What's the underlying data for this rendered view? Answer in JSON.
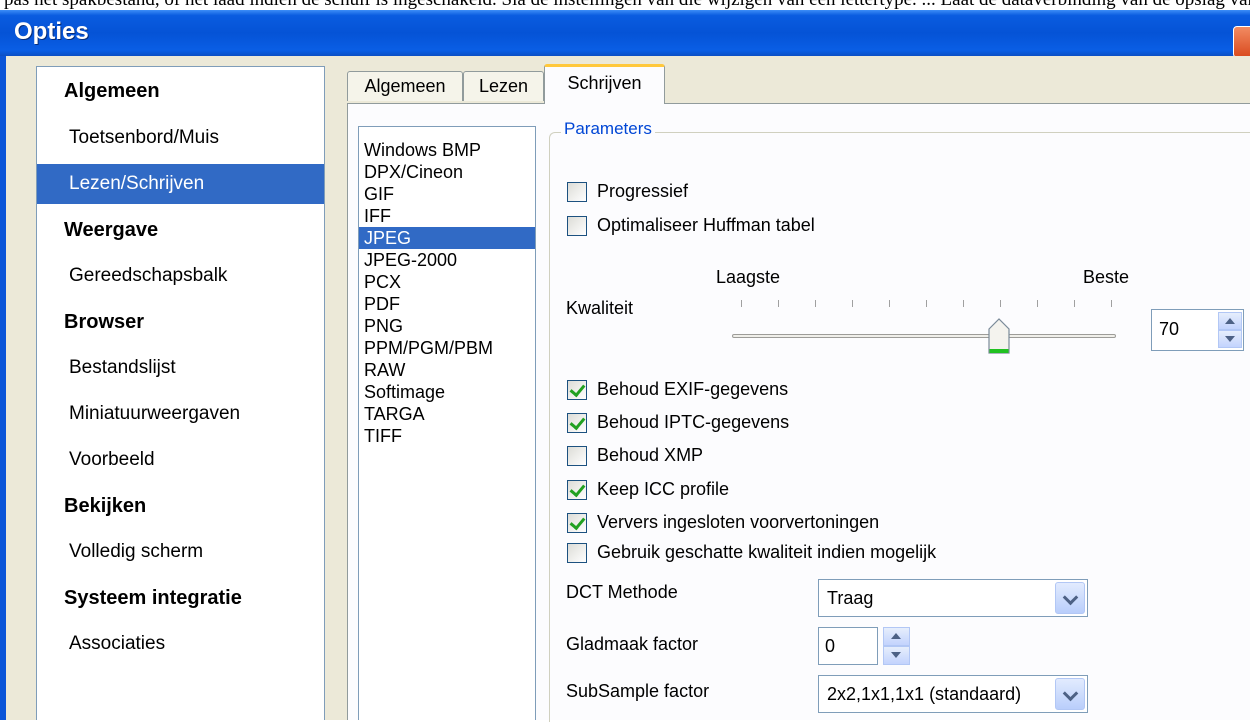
{
  "background_text": "pas het spakbestand, of het laad indien de schuif is ingeschakeld. Sla de instellingen van die wijzigen van een lettertype. ... Laat de dataverbinding van de opslag van de options ingeschakeld. Is het venster Opties uw spelling actief",
  "window": {
    "title": "Opties"
  },
  "tree": {
    "items": [
      {
        "label": "Algemeen",
        "type": "category"
      },
      {
        "label": "Toetsenbord/Muis",
        "type": "sub"
      },
      {
        "label": "Lezen/Schrijven",
        "type": "sub",
        "selected": true
      },
      {
        "label": "Weergave",
        "type": "category"
      },
      {
        "label": "Gereedschapsbalk",
        "type": "sub"
      },
      {
        "label": "Browser",
        "type": "category"
      },
      {
        "label": "Bestandslijst",
        "type": "sub"
      },
      {
        "label": "Miniatuurweergaven",
        "type": "sub"
      },
      {
        "label": "Voorbeeld",
        "type": "sub"
      },
      {
        "label": "Bekijken",
        "type": "category"
      },
      {
        "label": "Volledig scherm",
        "type": "sub"
      },
      {
        "label": "Systeem integratie",
        "type": "category"
      },
      {
        "label": "Associaties",
        "type": "sub"
      }
    ]
  },
  "tabs": [
    {
      "label": "Algemeen"
    },
    {
      "label": "Lezen"
    },
    {
      "label": "Schrijven",
      "active": true
    }
  ],
  "formats": [
    "Windows BMP",
    "DPX/Cineon",
    "GIF",
    "IFF",
    "JPEG",
    "JPEG-2000",
    "PCX",
    "PDF",
    "PNG",
    "PPM/PGM/PBM",
    "RAW",
    "Softimage",
    "TARGA",
    "TIFF"
  ],
  "selected_format": "JPEG",
  "params": {
    "group_title": "Parameters",
    "progressive": {
      "label": "Progressief",
      "checked": false
    },
    "optimize_huffman": {
      "label": "Optimaliseer Huffman tabel",
      "checked": false
    },
    "quality": {
      "label": "Kwaliteit",
      "low_label": "Laagste",
      "high_label": "Beste",
      "value": "70",
      "slider_fraction": 0.7
    },
    "keep_exif": {
      "label": "Behoud EXIF-gegevens",
      "checked": true
    },
    "keep_iptc": {
      "label": "Behoud IPTC-gegevens",
      "checked": true
    },
    "keep_xmp": {
      "label": "Behoud XMP",
      "checked": false
    },
    "keep_icc": {
      "label": "Keep ICC profile",
      "checked": true
    },
    "refresh_previews": {
      "label": "Ververs ingesloten voorvertoningen",
      "checked": true
    },
    "estimated_quality": {
      "label": "Gebruik geschatte kwaliteit indien mogelijk",
      "checked": false
    },
    "dct": {
      "label": "DCT Methode",
      "value": "Traag"
    },
    "smoothing": {
      "label": "Gladmaak factor",
      "value": "0"
    },
    "subsample": {
      "label": "SubSample factor",
      "value": "2x2,1x1,1x1 (standaard)"
    }
  },
  "colors": {
    "titlebar": "#0553d6",
    "selection": "#316ac5",
    "group_title": "#0046d5",
    "check": "#21a121"
  }
}
